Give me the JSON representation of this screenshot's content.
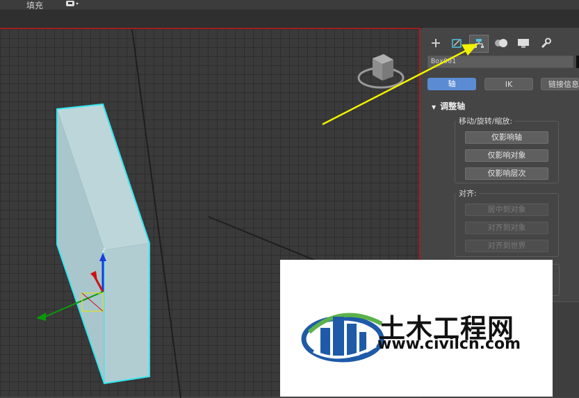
{
  "topbar": {
    "fill_label": "填充"
  },
  "command_panel": {
    "tabs": [
      {
        "name": "create",
        "icon": "plus-icon"
      },
      {
        "name": "modify",
        "icon": "modify-icon"
      },
      {
        "name": "hierarchy",
        "icon": "hierarchy-icon",
        "active": true
      },
      {
        "name": "motion",
        "icon": "motion-icon"
      },
      {
        "name": "display",
        "icon": "display-icon"
      },
      {
        "name": "utilities",
        "icon": "wrench-icon"
      }
    ],
    "object_name": "Box001",
    "segments": {
      "pivot": "轴",
      "ik": "IK",
      "link_info": "链接信息"
    },
    "rollout_title": "调整轴",
    "move_group": {
      "label": "移动/旋转/缩放:",
      "buttons": [
        "仅影响轴",
        "仅影响对象",
        "仅影响层次"
      ]
    },
    "align_group": {
      "label": "对齐:",
      "buttons": [
        "居中到对象",
        "对齐到对象",
        "对齐到世界"
      ]
    }
  },
  "viewport": {
    "gizmo_axis": "z"
  },
  "watermark": {
    "title": "土木工程网",
    "url": "www.civilcn.com"
  },
  "colors": {
    "selection_outline": "#33e6f0",
    "box_front": "#a9c6cc",
    "box_side": "#bcd6da",
    "active_button": "#5b8bd3",
    "annotation_arrow": "#f2f200",
    "viewport_border": "#a02020",
    "logo_blue": "#1e5aa8",
    "logo_green": "#5bb24a"
  }
}
